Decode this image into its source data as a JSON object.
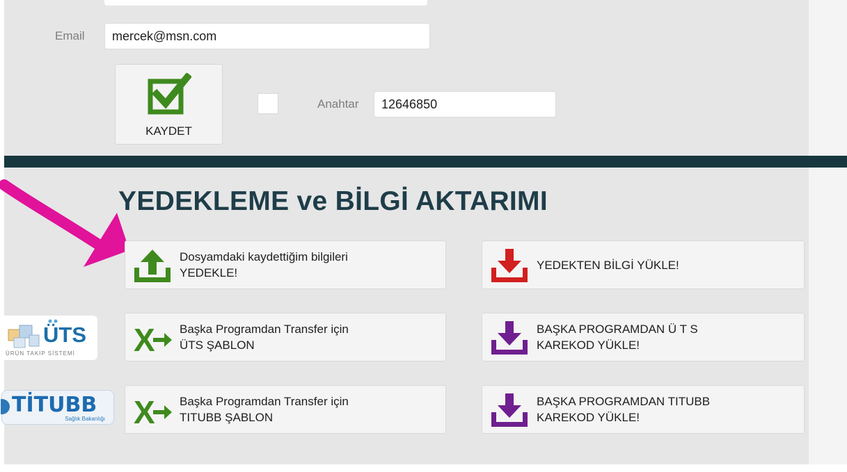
{
  "form": {
    "email_label": "Email",
    "email_value": "mercek@msn.com",
    "key_label": "Anahtar",
    "key_value": "12646850",
    "save_label": "KAYDET"
  },
  "section": {
    "title": "YEDEKLEME ve BİLGİ AKTARIMI"
  },
  "actions": [
    {
      "label": "Dosyamdaki kaydettiğim bilgileri\nYEDEKLE!",
      "icon": "upload-icon",
      "color": "#3f8a1e"
    },
    {
      "label": "YEDEKTEN BİLGİ YÜKLE!",
      "icon": "download-icon",
      "color": "#d21f1f"
    },
    {
      "label": "Başka Programdan Transfer için\nÜTS ŞABLON",
      "icon": "excel-export-icon",
      "color": "#3f8a1e"
    },
    {
      "label": "BAŞKA PROGRAMDAN  Ü T S\nKAREKOD YÜKLE!",
      "icon": "download-icon",
      "color": "#6f1f8f"
    },
    {
      "label": "Başka Programdan Transfer için\nTITUBB ŞABLON",
      "icon": "excel-export-icon",
      "color": "#3f8a1e"
    },
    {
      "label": "BAŞKA PROGRAMDAN TITUBB\nKAREKOD YÜKLE!",
      "icon": "download-icon",
      "color": "#6f1f8f"
    }
  ],
  "logos": {
    "uts_text": "ÜTS",
    "uts_sub": "ÜRÜN TAKİP SİSTEMİ",
    "titubb_text": "TİTUBB",
    "titubb_sub": "Sağlık Bakanlığı"
  },
  "colors": {
    "panel_bg": "#e6e6e6",
    "divider": "#17373f",
    "title": "#1e3d49",
    "annotation_arrow": "#e0139a",
    "check_green": "#3f8a1e"
  }
}
